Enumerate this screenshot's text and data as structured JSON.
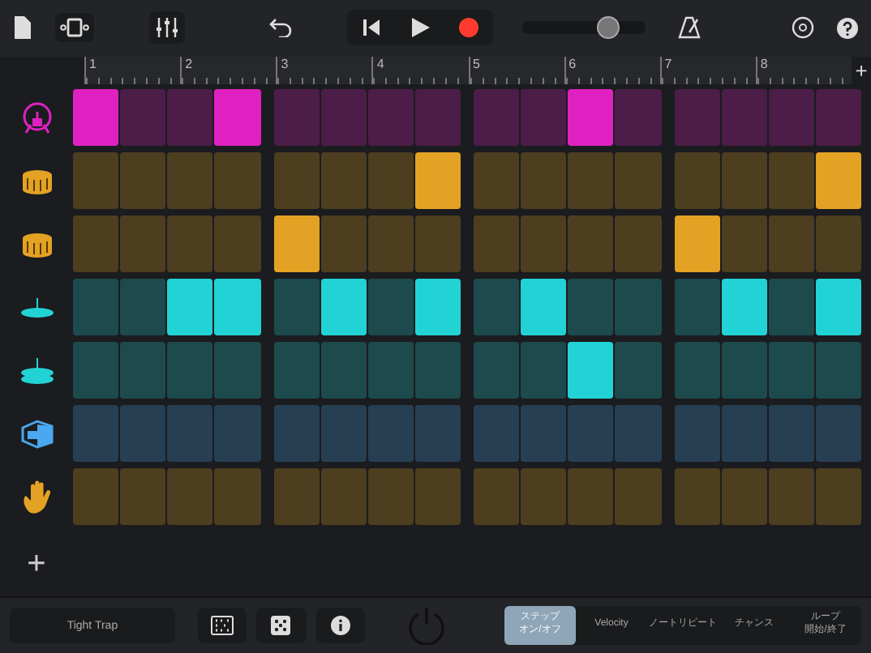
{
  "transport": {
    "recording": true,
    "volume": {
      "level": 0.7
    }
  },
  "ruler": {
    "bars": [
      "1",
      "2",
      "3",
      "4",
      "5",
      "6",
      "7",
      "8"
    ]
  },
  "tracks": [
    {
      "kind": "kick",
      "color": "#e021c2",
      "steps": [
        true,
        false,
        false,
        true,
        false,
        false,
        false,
        false,
        false,
        false,
        true,
        false,
        false,
        false,
        false,
        false
      ]
    },
    {
      "kind": "snare",
      "color": "#e3a224",
      "steps": [
        false,
        false,
        false,
        false,
        false,
        false,
        false,
        true,
        false,
        false,
        false,
        false,
        false,
        false,
        false,
        true
      ]
    },
    {
      "kind": "snare",
      "color": "#e3a224",
      "steps": [
        false,
        false,
        false,
        false,
        true,
        false,
        false,
        false,
        false,
        false,
        false,
        false,
        true,
        false,
        false,
        false
      ]
    },
    {
      "kind": "hihat",
      "color": "#22d3d6",
      "steps": [
        false,
        false,
        true,
        true,
        false,
        true,
        false,
        true,
        false,
        true,
        false,
        false,
        false,
        true,
        false,
        true
      ]
    },
    {
      "kind": "cymbal",
      "color": "#22d3d6",
      "steps": [
        false,
        false,
        false,
        false,
        false,
        false,
        false,
        false,
        false,
        false,
        true,
        false,
        false,
        false,
        false,
        false
      ]
    },
    {
      "kind": "speaker",
      "color": "#4aa8f0",
      "steps": [
        false,
        false,
        false,
        false,
        false,
        false,
        false,
        false,
        false,
        false,
        false,
        false,
        false,
        false,
        false,
        false
      ]
    },
    {
      "kind": "clap",
      "color": "#e3a224",
      "steps": [
        false,
        false,
        false,
        false,
        false,
        false,
        false,
        false,
        false,
        false,
        false,
        false,
        false,
        false,
        false,
        false
      ]
    }
  ],
  "add_track": "+",
  "pattern": "Tight Trap",
  "modes": [
    {
      "lines": [
        "ステップ",
        "オン/オフ"
      ],
      "selected": true
    },
    {
      "lines": [
        "Velocity"
      ],
      "selected": false
    },
    {
      "lines": [
        "ノートリピート"
      ],
      "selected": false
    },
    {
      "lines": [
        "チャンス"
      ],
      "selected": false
    },
    {
      "lines": [
        "ループ",
        "開始/終了"
      ],
      "selected": false
    }
  ]
}
